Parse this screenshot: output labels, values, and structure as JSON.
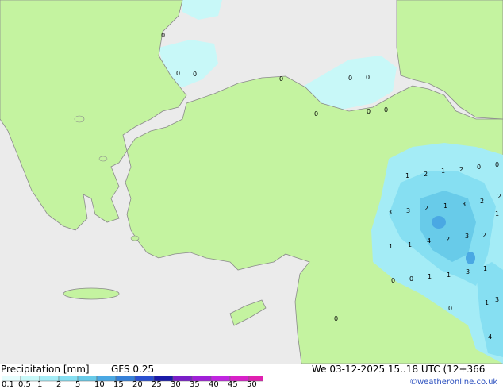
{
  "map_labels": [
    "0",
    "0",
    "0",
    "0",
    "0",
    "0",
    "0",
    "0",
    "0",
    "1",
    "2",
    "1",
    "2",
    "0",
    "0",
    "2",
    "1",
    "3",
    "2",
    "3",
    "3",
    "2",
    "1",
    "3",
    "2",
    "4",
    "2",
    "1",
    "1",
    "3",
    "1",
    "0",
    "0",
    "1",
    "1",
    "3",
    "0",
    "0",
    "1",
    "4"
  ],
  "legend": {
    "title": "Precipitation [mm]",
    "model": "GFS 0.25",
    "scale_labels": [
      "0.1",
      "0.5",
      "1",
      "2",
      "5",
      "10",
      "15",
      "20",
      "25",
      "30",
      "35",
      "40",
      "45",
      "50"
    ],
    "scale_colors": [
      "#e6fdfd",
      "#c8f8f8",
      "#a4ecf6",
      "#86dff2",
      "#68cbe9",
      "#4aa8e3",
      "#3580d8",
      "#2a4fd0",
      "#1a1aa8",
      "#7a1ec8",
      "#a020d8",
      "#c025e0",
      "#d820c8",
      "#e020b0"
    ]
  },
  "run_info": "We 03-12-2025 15..18 UTC (12+366",
  "credit": "©weatheronline.co.uk"
}
